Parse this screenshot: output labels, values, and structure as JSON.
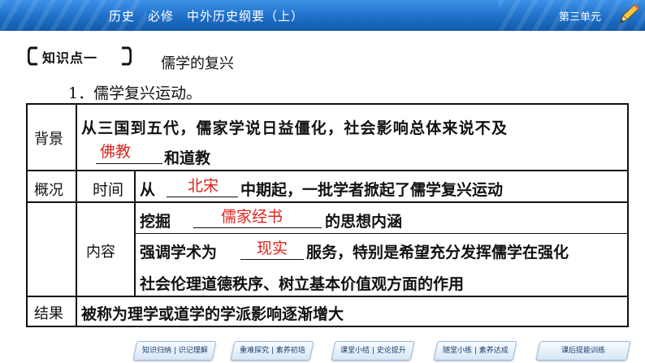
{
  "header": {
    "course_title": "历史　必修　中外历史纲要（上）",
    "unit": "第三单元",
    "icon": "pencil-icon"
  },
  "knowledge_point": {
    "tag": "知识点一",
    "heading": "儒学的复兴"
  },
  "section_title": "1．儒学复兴运动。",
  "table": {
    "background": {
      "label": "背景",
      "line1": "从三国到五代，儒家学说日益僵化，社会影响总体来说不及",
      "answer": "佛教",
      "suffix": "和道教"
    },
    "overview": {
      "label": "概况",
      "sublabel": "时间",
      "prefix": "从",
      "answer": "北宋",
      "suffix": "中期起，一批学者掀起了儒学复兴运动"
    },
    "content": {
      "label": "内容",
      "row1_prefix": "挖掘",
      "row1_answer": "儒家经书",
      "row1_suffix": "的思想内涵",
      "row2_prefix": "强调学术为",
      "row2_answer": "现实",
      "row2_suffix": "服务，特别是希望充分发挥儒学在强化",
      "row3": "社会伦理道德秩序、树立基本价值观方面的作用"
    },
    "result": {
      "label": "结果",
      "text": "被称为理学或道学的学派影响逐渐增大"
    }
  },
  "nav": [
    {
      "label": "知识归纳 | 识记理解"
    },
    {
      "label": "重难探究 | 素养初培"
    },
    {
      "label": "课堂小结 | 史论提升"
    },
    {
      "label": "随堂小练 | 素养达成"
    },
    {
      "label": "课后提能训练"
    }
  ],
  "colors": {
    "banner": "#1f6fc9",
    "answer": "#d9261c",
    "nav_text": "#1b3e6b"
  }
}
